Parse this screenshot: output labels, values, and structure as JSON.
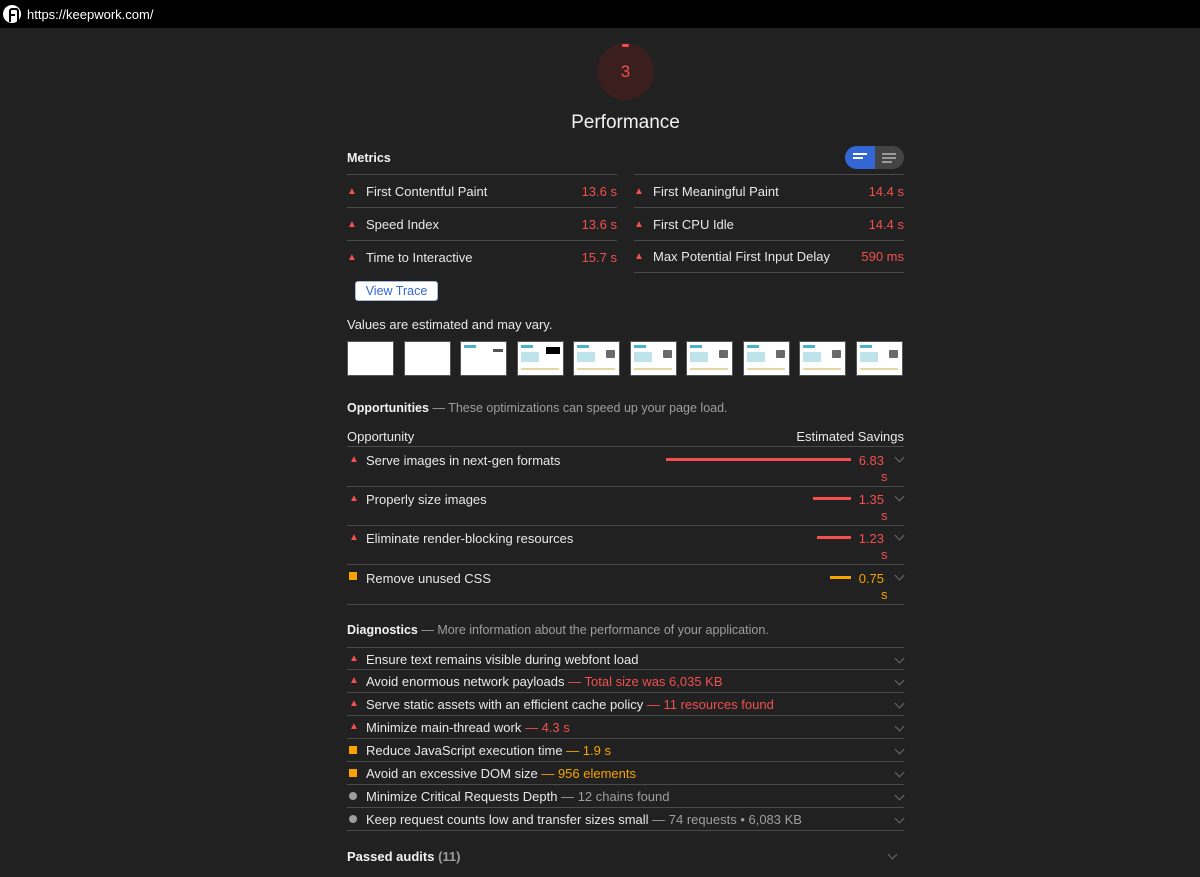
{
  "browser": {
    "url": "https://keepwork.com/"
  },
  "gauge": {
    "score": "3",
    "title": "Performance",
    "color": "#f34f4f"
  },
  "metrics": {
    "title": "Metrics",
    "items": [
      {
        "label": "First Contentful Paint",
        "value": "13.6 s"
      },
      {
        "label": "First Meaningful Paint",
        "value": "14.4 s"
      },
      {
        "label": "Speed Index",
        "value": "13.6 s"
      },
      {
        "label": "First CPU Idle",
        "value": "14.4 s"
      },
      {
        "label": "Time to Interactive",
        "value": "15.7 s"
      },
      {
        "label": "Max Potential First Input Delay",
        "value": "590 ms"
      }
    ],
    "view_trace": "View Trace",
    "note": "Values are estimated and may vary."
  },
  "opportunities": {
    "title": "Opportunities",
    "desc": "— These optimizations can speed up your page load.",
    "col_left": "Opportunity",
    "col_right": "Estimated Savings",
    "items": [
      {
        "label": "Serve images in next-gen formats",
        "value": "6.83",
        "unit": "s",
        "severity": "fail",
        "fraction": 1.0
      },
      {
        "label": "Properly size images",
        "value": "1.35",
        "unit": "s",
        "severity": "fail",
        "fraction": 0.2
      },
      {
        "label": "Eliminate render-blocking resources",
        "value": "1.23",
        "unit": "s",
        "severity": "fail",
        "fraction": 0.18
      },
      {
        "label": "Remove unused CSS",
        "value": "0.75",
        "unit": "s",
        "severity": "average",
        "fraction": 0.11
      }
    ]
  },
  "diagnostics": {
    "title": "Diagnostics",
    "desc": "— More information about the performance of your application.",
    "items": [
      {
        "label": "Ensure text remains visible during webfont load",
        "detail": ""
      },
      {
        "label": "Avoid enormous network payloads",
        "detail": "— Total size was 6,035 KB"
      },
      {
        "label": "Serve static assets with an efficient cache policy",
        "detail": "— 11 resources found"
      },
      {
        "label": "Minimize main-thread work",
        "detail": "— 4.3 s"
      },
      {
        "label": "Reduce JavaScript execution time",
        "detail": "— 1.9 s"
      },
      {
        "label": "Avoid an excessive DOM size",
        "detail": "— 956 elements"
      },
      {
        "label": "Minimize Critical Requests Depth",
        "detail": "— 12 chains found"
      },
      {
        "label": "Keep request counts low and transfer sizes small",
        "detail": "— 74 requests • 6,083 KB"
      }
    ]
  },
  "passed": {
    "label": "Passed audits",
    "count": "(11)"
  },
  "colors": {
    "fail": "#f34f4f",
    "average": "#f8a300",
    "info": "#9e9e9e",
    "accent": "#3367d6"
  }
}
